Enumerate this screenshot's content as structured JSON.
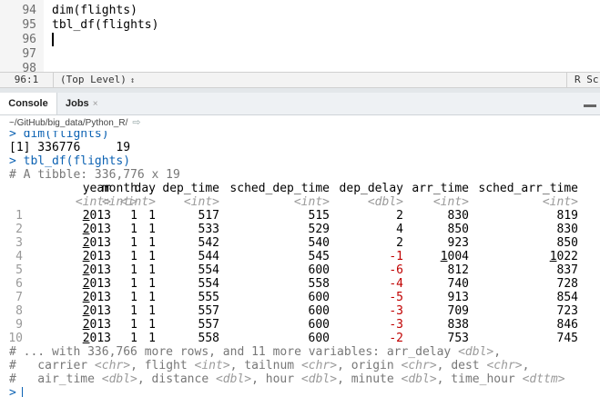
{
  "editor": {
    "lines": [
      {
        "num": "94",
        "code": "dim(flights)"
      },
      {
        "num": "95",
        "code": "tbl_df(flights)"
      },
      {
        "num": "96",
        "code": ""
      },
      {
        "num": "97",
        "code": ""
      },
      {
        "num": "98",
        "code": ""
      }
    ]
  },
  "statusbar": {
    "position": "96:1",
    "scope": "(Top Level)",
    "scope_arrow": "↕",
    "filetype": "R Scri"
  },
  "tabs": {
    "console": "Console",
    "jobs": "Jobs",
    "jobs_close": "×"
  },
  "path": {
    "text": "~/GitHub/big_data/Python_R/",
    "arrow": "⇨"
  },
  "console": {
    "prompt": ">",
    "cmd_dim": "dim(flights)",
    "dim_output": "[1] 336776     19",
    "cmd_tbl": "tbl_df(flights)",
    "tibble_header": "# A tibble: 336,776 x 19",
    "columns": [
      "year",
      "month",
      "day",
      "dep_time",
      "sched_dep_time",
      "dep_delay",
      "arr_time",
      "sched_arr_time"
    ],
    "types": [
      "<int>",
      "<int>",
      "<int>",
      "<int>",
      "<int>",
      "<dbl>",
      "<int>",
      "<int>"
    ],
    "rows": [
      {
        "idx": "1",
        "year": "2013",
        "month": "1",
        "day": "1",
        "dep_time": "517",
        "sched_dep_time": "515",
        "dep_delay": "2",
        "arr_time": "830",
        "sched_arr_time": "819"
      },
      {
        "idx": "2",
        "year": "2013",
        "month": "1",
        "day": "1",
        "dep_time": "533",
        "sched_dep_time": "529",
        "dep_delay": "4",
        "arr_time": "850",
        "sched_arr_time": "830"
      },
      {
        "idx": "3",
        "year": "2013",
        "month": "1",
        "day": "1",
        "dep_time": "542",
        "sched_dep_time": "540",
        "dep_delay": "2",
        "arr_time": "923",
        "sched_arr_time": "850"
      },
      {
        "idx": "4",
        "year": "2013",
        "month": "1",
        "day": "1",
        "dep_time": "544",
        "sched_dep_time": "545",
        "dep_delay": "-1",
        "arr_time": "1004",
        "sched_arr_time": "1022"
      },
      {
        "idx": "5",
        "year": "2013",
        "month": "1",
        "day": "1",
        "dep_time": "554",
        "sched_dep_time": "600",
        "dep_delay": "-6",
        "arr_time": "812",
        "sched_arr_time": "837"
      },
      {
        "idx": "6",
        "year": "2013",
        "month": "1",
        "day": "1",
        "dep_time": "554",
        "sched_dep_time": "558",
        "dep_delay": "-4",
        "arr_time": "740",
        "sched_arr_time": "728"
      },
      {
        "idx": "7",
        "year": "2013",
        "month": "1",
        "day": "1",
        "dep_time": "555",
        "sched_dep_time": "600",
        "dep_delay": "-5",
        "arr_time": "913",
        "sched_arr_time": "854"
      },
      {
        "idx": "8",
        "year": "2013",
        "month": "1",
        "day": "1",
        "dep_time": "557",
        "sched_dep_time": "600",
        "dep_delay": "-3",
        "arr_time": "709",
        "sched_arr_time": "723"
      },
      {
        "idx": "9",
        "year": "2013",
        "month": "1",
        "day": "1",
        "dep_time": "557",
        "sched_dep_time": "600",
        "dep_delay": "-3",
        "arr_time": "838",
        "sched_arr_time": "846"
      },
      {
        "idx": "10",
        "year": "2013",
        "month": "1",
        "day": "1",
        "dep_time": "558",
        "sched_dep_time": "600",
        "dep_delay": "-2",
        "arr_time": "753",
        "sched_arr_time": "745"
      }
    ],
    "footer": [
      {
        "pre": "# ... with 336,766 more rows, and 11 more variables: arr_delay ",
        "segs": [
          [
            "<dbl>",
            ","
          ]
        ]
      },
      {
        "pre": "#   carrier ",
        "segs": [
          [
            "<chr>",
            ", flight "
          ],
          [
            "<int>",
            ", tailnum "
          ],
          [
            "<chr>",
            ", origin "
          ],
          [
            "<chr>",
            ", dest "
          ],
          [
            "<chr>",
            ","
          ]
        ]
      },
      {
        "pre": "#   air_time ",
        "segs": [
          [
            "<dbl>",
            ", distance "
          ],
          [
            "<dbl>",
            ", hour "
          ],
          [
            "<dbl>",
            ", minute "
          ],
          [
            "<dbl>",
            ", time_hour "
          ],
          [
            "<dttm>",
            ""
          ]
        ]
      }
    ]
  },
  "colors": {
    "prompt": "#0c62b3",
    "negative": "#c00000",
    "comment": "#777777"
  }
}
